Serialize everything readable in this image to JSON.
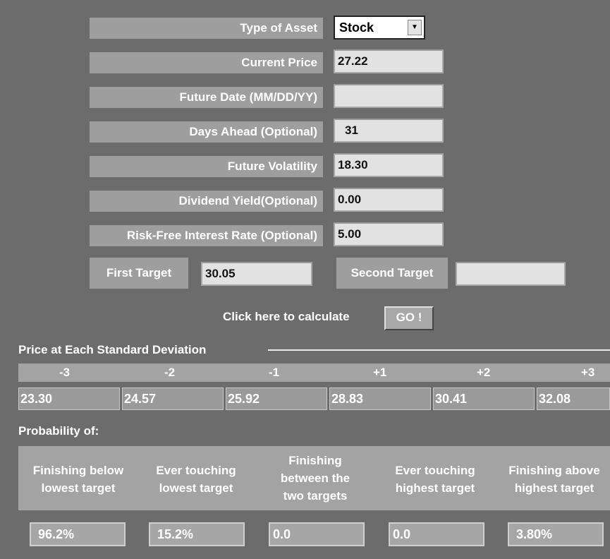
{
  "form": {
    "asset_type_label": "Type of Asset",
    "asset_type_value": "Stock",
    "current_price_label": "Current Price",
    "current_price_value": "27.22",
    "future_date_label": "Future Date (MM/DD/YY)",
    "future_date_value": "",
    "days_ahead_label": "Days Ahead (Optional)",
    "days_ahead_value": "31",
    "future_volatility_label": "Future Volatility",
    "future_volatility_value": "18.30",
    "dividend_yield_label": "Dividend Yield(Optional)",
    "dividend_yield_value": "0.00",
    "risk_free_label": "Risk-Free Interest Rate (Optional)",
    "risk_free_value": "5.00",
    "first_target_label": "First Target",
    "first_target_value": "30.05",
    "second_target_label": "Second Target",
    "second_target_value": "",
    "calculate_prompt": "Click here to calculate",
    "go_label": "GO !"
  },
  "std_dev": {
    "title": "Price at Each Standard Deviation",
    "headers": [
      "-3",
      "-2",
      "-1",
      "+1",
      "+2",
      "+3"
    ],
    "values": [
      "23.30",
      "24.57",
      "25.92",
      "28.83",
      "30.41",
      "32.08"
    ]
  },
  "probability": {
    "title": "Probability of:",
    "headers": [
      [
        "Finishing below",
        "lowest target"
      ],
      [
        "Ever touching",
        "lowest target"
      ],
      [
        "Finishing",
        "between the",
        "two targets"
      ],
      [
        "Ever touching",
        "highest target"
      ],
      [
        "Finishing above",
        "highest target"
      ]
    ],
    "values": [
      "96.2%",
      "15.2%",
      "0.0",
      "0.0",
      "3.80%"
    ]
  }
}
